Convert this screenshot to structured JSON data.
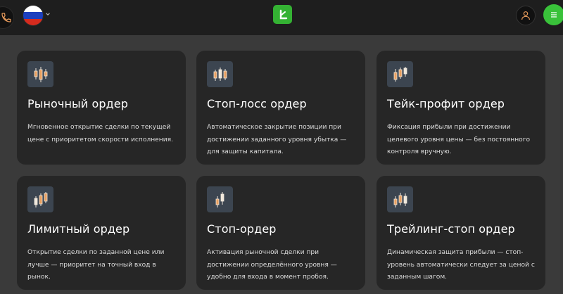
{
  "header": {
    "phone_icon": "phone-icon",
    "flag_icon": "russia-flag-icon",
    "flag_colors": [
      "#ffffff",
      "#1c3fbe",
      "#d52b1e"
    ],
    "logo_icon": "app-logo-icon",
    "logo_color": "#34b233",
    "profile_icon": "user-icon",
    "menu_icon": "menu-icon",
    "accent": "#39c23a"
  },
  "cards": [
    {
      "icon": "candlestick-icon",
      "title": "Рыночный ордер",
      "desc": "Мгновенное открытие сделки по текущей цене с приоритетом скорости исполнения."
    },
    {
      "icon": "candlestick-icon",
      "title": "Стоп-лосс ордер",
      "desc": "Автоматическое закрытие позиции при достижении заданного уровня убытка — для защиты капитала."
    },
    {
      "icon": "candlestick-icon",
      "title": "Тейк-профит ордер",
      "desc": "Фиксация прибыли при достижении целевого уровня цены — без постоянного контроля вручную."
    },
    {
      "icon": "candlestick-icon",
      "title": "Лимитный ордер",
      "desc": "Открытие сделки по заданной цене или лучше — приоритет на точный вход в рынок."
    },
    {
      "icon": "candlestick-icon",
      "title": "Стоп-ордер",
      "desc": "Активация рыночной сделки при достижении определённого уровня — удобно для входа в момент пробоя."
    },
    {
      "icon": "candlestick-icon",
      "title": "Трейлинг-стоп ордер",
      "desc": "Динамическая защита прибыли — стоп-уровень автоматически следует за ценой с заданным шагом."
    }
  ]
}
